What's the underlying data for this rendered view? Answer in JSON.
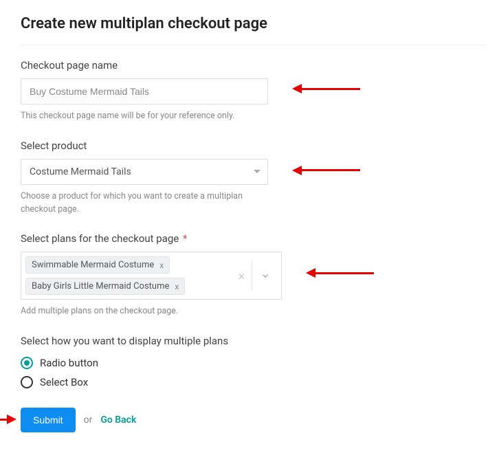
{
  "page": {
    "title": "Create new multiplan checkout page"
  },
  "fields": {
    "name": {
      "label": "Checkout page name",
      "value": "Buy Costume Mermaid Tails",
      "helper": "This checkout page name will be for your reference only."
    },
    "product": {
      "label": "Select product",
      "selected": "Costume Mermaid Tails",
      "helper": "Choose a product for which you want to create a multiplan checkout page."
    },
    "plans": {
      "label": "Select plans for the checkout page",
      "required_marker": "*",
      "chips": [
        "Swimmable Mermaid Costume",
        "Baby Girls Little Mermaid Costume"
      ],
      "chip_remove": "x",
      "helper": "Add multiple plans on the checkout page."
    },
    "display": {
      "label": "Select how you want to display multiple plans",
      "options": {
        "radio": "Radio button",
        "select": "Select Box"
      },
      "selected": "radio"
    }
  },
  "actions": {
    "submit": "Submit",
    "or": "or",
    "go_back": "Go Back"
  }
}
